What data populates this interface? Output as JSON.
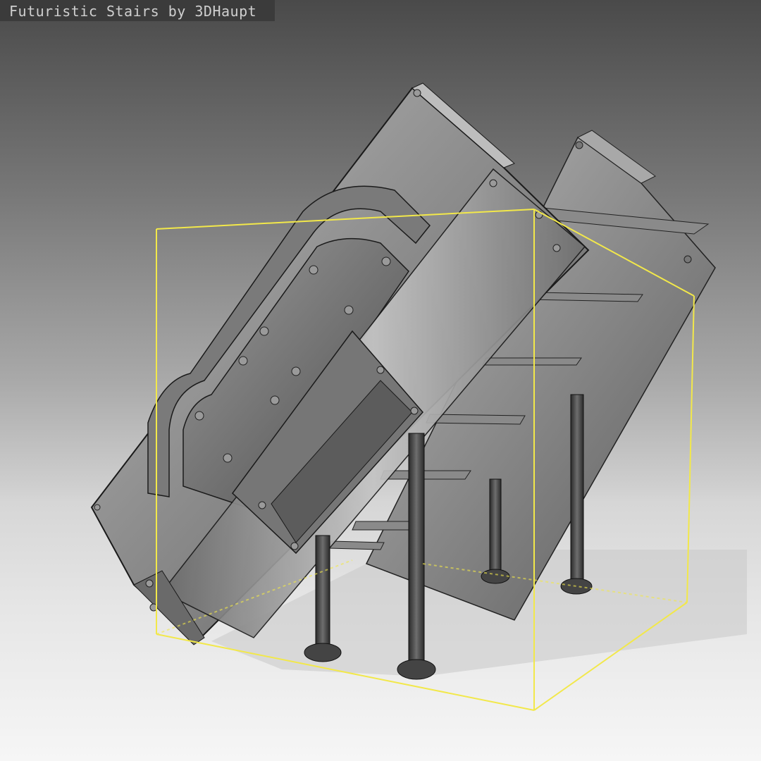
{
  "viewport": {
    "title": "Futuristic Stairs by 3DHaupt",
    "selection_color": "#f2e84a",
    "background_top": "#4a4a4a",
    "floor_color": "#f6f6f6",
    "model_color": "#8a8a8a"
  },
  "model": {
    "name": "futuristic-stairs",
    "steps": 7,
    "legs": 4
  }
}
